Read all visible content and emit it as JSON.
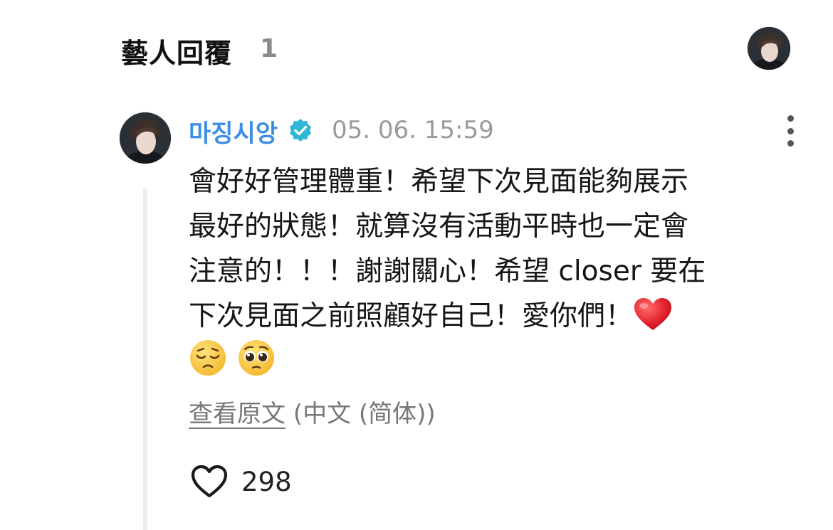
{
  "header": {
    "title": "藝人回覆",
    "count": "1"
  },
  "comment": {
    "author": "마징시앙",
    "verified": true,
    "timestamp": "05. 06. 15:59",
    "body_lines": [
      "會好好管理體重！希望下次見面能夠展示",
      "最好的狀態！就算沒有活動平時也一定會",
      "注意的！！！謝謝關心！希望 closer 要在",
      "下次見面之前照顧好自己！愛你們！"
    ],
    "emojis": [
      "red-heart-emoji",
      "pensive-face-emoji",
      "pleading-face-emoji"
    ],
    "translation": {
      "link_label": "查看原文",
      "language": "(中文 (简体))"
    },
    "like_count": "298"
  },
  "colors": {
    "author": "#3d8ee6",
    "verified": "#2fb5d6",
    "muted": "#9a9a9a",
    "thread_line": "#ececec"
  }
}
